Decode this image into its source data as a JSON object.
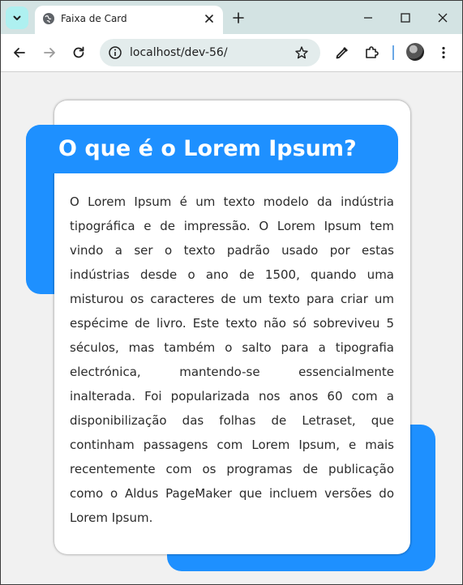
{
  "browser": {
    "tab_title": "Faixa de Card",
    "url": "localhost/dev-56/"
  },
  "content": {
    "title": "O que é o Lorem Ipsum?",
    "body": "O Lorem Ipsum é um texto modelo da indústria tipográfica e de impressão. O Lorem Ipsum tem vindo a ser o texto padrão usado por estas indústrias desde o ano de 1500, quando uma misturou os caracteres de um texto para criar um espécime de livro. Este texto não só sobreviveu 5 séculos, mas também o salto para a tipografia electrónica, mantendo-se essencialmente inalterada. Foi popularizada nos anos 60 com a disponibilização das folhas de Letraset, que continham passagens com Lorem Ipsum, e mais recentemente com os programas de publicação como o Aldus PageMaker que incluem versões do Lorem Ipsum."
  },
  "colors": {
    "accent": "#1e90ff",
    "card": "#ffffff",
    "page_background": "#f1f1f1",
    "tabstrip": "#d3e3e3"
  },
  "icons": {
    "tab_search": "chevron-down-icon",
    "favicon": "globe-icon",
    "tab_close": "close-icon",
    "new_tab": "plus-icon",
    "minimize": "minimize-icon",
    "maximize": "maximize-icon",
    "close_window": "close-icon",
    "back": "arrow-left-icon",
    "forward": "arrow-right-icon",
    "reload": "reload-icon",
    "site_info": "info-icon",
    "bookmark": "star-icon",
    "eyedropper": "eyedropper-icon",
    "extensions": "puzzle-icon",
    "profile": "avatar",
    "menu": "more-vertical-icon"
  }
}
